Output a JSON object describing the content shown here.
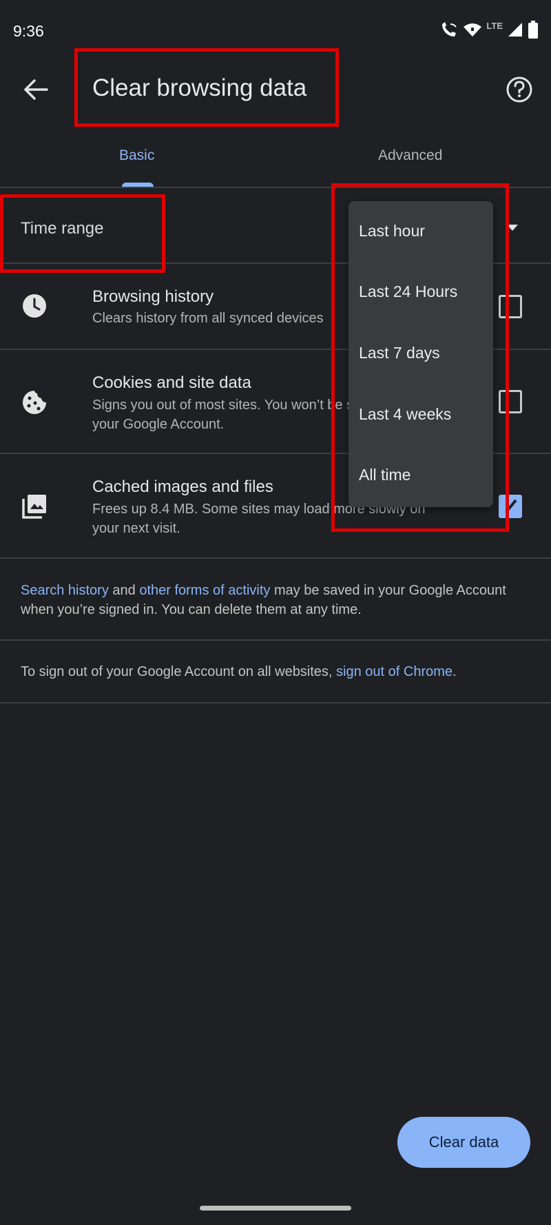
{
  "status_bar": {
    "time": "9:36",
    "network": "LTE"
  },
  "app_bar": {
    "title": "Clear browsing data"
  },
  "tabs": [
    {
      "label": "Basic",
      "selected": true
    },
    {
      "label": "Advanced",
      "selected": false
    }
  ],
  "time_range": {
    "label": "Time range"
  },
  "rows": [
    {
      "title": "Browsing history",
      "desc": "Clears history from all synced devices",
      "checked": false
    },
    {
      "title": "Cookies and site data",
      "desc": "Signs you out of most sites. You won’t be signed out of your Google Account.",
      "checked": false
    },
    {
      "title": "Cached images and files",
      "desc": "Frees up 8.4 MB. Some sites may load more slowly on your next visit.",
      "checked": true
    }
  ],
  "info": {
    "link1": "Search history",
    "and": " and ",
    "link2": "other forms of activity",
    "rest": " may be saved in your Google Account when you’re signed in. You can delete them at any time.",
    "signout_prefix": "To sign out of your Google Account on all websites, ",
    "signout_link": "sign out of Chrome",
    "signout_suffix": "."
  },
  "menu": {
    "items": [
      "Last hour",
      "Last 24 Hours",
      "Last 7 days",
      "Last 4 weeks",
      "All time"
    ]
  },
  "clear_button": {
    "label": "Clear data"
  },
  "colors": {
    "background": "#1f2023",
    "accent": "#8ab4f8",
    "annotation": "#e00000"
  }
}
